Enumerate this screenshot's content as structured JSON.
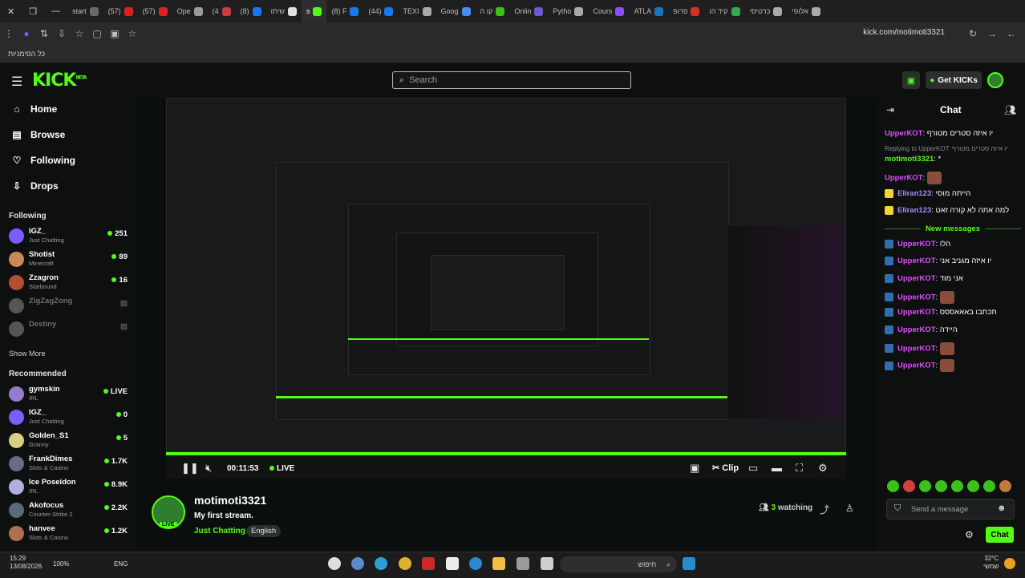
{
  "browser": {
    "tabs": [
      {
        "label": "start",
        "color": "#6a6a6a"
      },
      {
        "label": "(57)",
        "color": "#e02020"
      },
      {
        "label": "(57)",
        "color": "#e02020"
      },
      {
        "label": "Ope",
        "color": "#9a9a9a"
      },
      {
        "label": "(4",
        "color": "#c83c3c"
      },
      {
        "label": "(8)",
        "color": "#1877f2"
      },
      {
        "label": "שיתו",
        "color": "#e0e0e0"
      },
      {
        "label": "s",
        "color": "#53fc18",
        "active": true
      },
      {
        "label": "(8) F",
        "color": "#1877f2"
      },
      {
        "label": "(44)",
        "color": "#1877f2"
      },
      {
        "label": "TEXI",
        "color": "#aaaaaa"
      },
      {
        "label": "Goog",
        "color": "#4c8bf5"
      },
      {
        "label": "קו ה",
        "color": "#3ac21a"
      },
      {
        "label": "Onlin",
        "color": "#6a5acd"
      },
      {
        "label": "Pytho",
        "color": "#aaaaaa"
      },
      {
        "label": "Cours",
        "color": "#8a4dff"
      },
      {
        "label": "ATLA",
        "color": "#1b75bc"
      },
      {
        "label": "פרופ",
        "color": "#d93025"
      },
      {
        "label": "קיד הו",
        "color": "#34a853"
      },
      {
        "label": "כרטיסי",
        "color": "#aaaaaa"
      },
      {
        "label": "אלופי",
        "color": "#aaaaaa"
      }
    ],
    "url": "kick.com/motimoti3321",
    "bookmark_label": "כל הסימניות"
  },
  "header": {
    "logo": "KICK",
    "logo_sup": "BETA",
    "search_placeholder": "Search",
    "get_kicks": "Get KICKs"
  },
  "sidebar": {
    "nav": [
      {
        "label": "Home",
        "icon": "home-icon",
        "glyph": "⌂"
      },
      {
        "label": "Browse",
        "icon": "browse-icon",
        "glyph": "▤"
      },
      {
        "label": "Following",
        "icon": "heart-icon",
        "glyph": "♡"
      },
      {
        "label": "Drops",
        "icon": "drops-icon",
        "glyph": "⇩"
      }
    ],
    "following_label": "Following",
    "following": [
      {
        "name": "IGZ_",
        "category": "Just Chatting",
        "viewers": "251",
        "online": true,
        "color": "#7a5cff"
      },
      {
        "name": "Shotist",
        "category": "Minecraft",
        "viewers": "89",
        "online": true,
        "color": "#c98a5a"
      },
      {
        "name": "Zzagron",
        "category": "Starbound",
        "viewers": "16",
        "online": true,
        "color": "#b05030"
      },
      {
        "name": "ZigZagZong",
        "category": "",
        "viewers": "",
        "online": false,
        "color": "#555555"
      },
      {
        "name": "Destiny",
        "category": "",
        "viewers": "",
        "online": false,
        "color": "#555555"
      }
    ],
    "show_more": "Show More",
    "recommended_label": "Recommended",
    "recommended": [
      {
        "name": "gymskin",
        "category": "IRL",
        "viewers": "LIVE",
        "color": "#9a7ad0"
      },
      {
        "name": "IGZ_",
        "category": "Just Chatting",
        "viewers": "0",
        "color": "#7a5cff"
      },
      {
        "name": "Golden_S1",
        "category": "Granny",
        "viewers": "5",
        "color": "#d8d080"
      },
      {
        "name": "FrankDimes",
        "category": "Slots & Casino",
        "viewers": "1.7K",
        "color": "#6a6a8a"
      },
      {
        "name": "Ice Poseidon",
        "category": "IRL",
        "viewers": "8.9K",
        "color": "#b0b0e0"
      },
      {
        "name": "Akofocus",
        "category": "Counter-Strike 2",
        "viewers": "2.2K",
        "color": "#5a6a7a"
      },
      {
        "name": "hanvee",
        "category": "Slots & Casino",
        "viewers": "1.2K",
        "color": "#b07050"
      }
    ]
  },
  "player": {
    "time": "00:11:53",
    "live_label": "LIVE",
    "clip_label": "Clip"
  },
  "stream": {
    "channel": "motimoti3321",
    "title": "My first stream.",
    "category": "Just Chatting",
    "language": "English",
    "live_badge": "LIVE",
    "watching_count": "3",
    "watching_label": "watching"
  },
  "chat": {
    "title": "Chat",
    "messages_top": [
      {
        "user": "UpperKOT",
        "text": "יו איזה סטרים מטורף"
      },
      {
        "user": "",
        "text": "Replying to UpperKOT: יו איזה סטרים מטורף"
      },
      {
        "user": "motimoti3321",
        "text": "*"
      },
      {
        "user": "UpperKOT",
        "text": ""
      },
      {
        "user": "Eliran123",
        "text": "הייתה מוסי"
      },
      {
        "user": "Eliran123",
        "text": "למה אתה לא קורה זאט"
      }
    ],
    "new_messages_label": "New messages",
    "messages_new": [
      {
        "user": "UpperKOT",
        "text": "הלו"
      },
      {
        "user": "UpperKOT",
        "text": "יו איזה מגניב אני"
      },
      {
        "user": "UpperKOT",
        "text": "אני מוד"
      },
      {
        "user": "UpperKOT",
        "text": ""
      },
      {
        "user": "UpperKOT",
        "text": "תכתבו באאאססס"
      },
      {
        "user": "UpperKOT",
        "text": "היידה"
      },
      {
        "user": "UpperKOT",
        "text": ""
      },
      {
        "user": "UpperKOT",
        "text": ""
      }
    ],
    "input_placeholder": "Send a message",
    "send_label": "Chat"
  },
  "taskbar": {
    "time": "15:29",
    "date": "13/08/2026",
    "zoom": "100%",
    "language": "ENG",
    "search_placeholder": "חיפוש",
    "temperature": "32°C",
    "weather": "שמשי"
  }
}
